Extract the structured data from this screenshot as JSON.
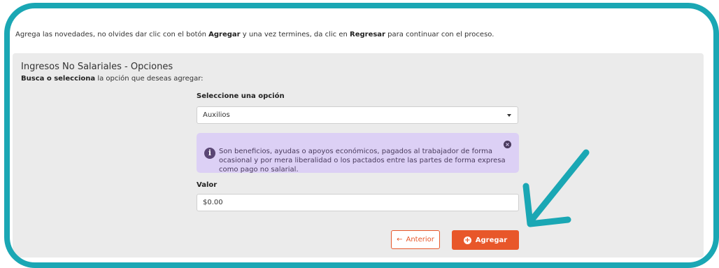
{
  "instructions": {
    "part1": "Agrega las novedades, no olvides dar clic con el botón ",
    "bold1": "Agregar",
    "part2": " y una vez termines, da clic en ",
    "bold2": "Regresar",
    "part3": " para continuar con el proceso."
  },
  "panel": {
    "title": "Ingresos No Salariales - Opciones",
    "subtitle_bold": "Busca o selecciona",
    "subtitle_rest": " la opción que deseas agregar:"
  },
  "select": {
    "label": "Seleccione una opción",
    "value": "Auxilios"
  },
  "info": {
    "text": "Son beneficios, ayudas o apoyos económicos, pagados al trabajador de forma ocasional y por mera liberalidad o los pactados entre las partes de forma expresa como pago no salarial.",
    "icon_glyph": "i",
    "close_glyph": "×"
  },
  "valor": {
    "label": "Valor",
    "value": "$0.00"
  },
  "buttons": {
    "prev_label": "Anterior",
    "prev_icon": "←",
    "add_label": "Agregar",
    "add_icon": "+"
  },
  "colors": {
    "frame": "#1aa7b4",
    "accent": "#e8572a",
    "info_bg": "#dcd0f5"
  }
}
